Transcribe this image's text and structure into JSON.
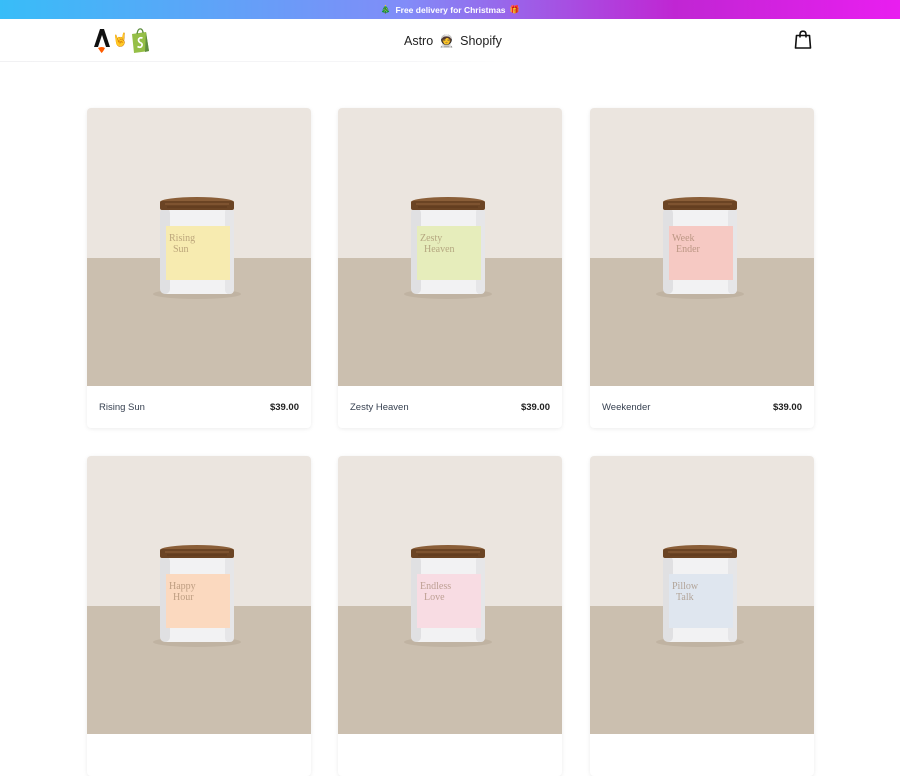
{
  "promo": {
    "text": "Free delivery for Christmas",
    "left_icon": "christmas-tree-icon",
    "right_icon": "gift-icon"
  },
  "header": {
    "brand_left": "Astro",
    "brand_icon": "astronaut-icon",
    "brand_right": "Shopify",
    "logo_icons": [
      "astro-logo-icon",
      "rock-hand-icon",
      "shopify-bag-icon"
    ],
    "cart_icon": "shopping-bag-icon"
  },
  "products": [
    {
      "name": "Rising Sun",
      "price": "$39.00",
      "label_color": "#f7ebb0",
      "label_text_1": "Rising",
      "label_text_2": "Sun"
    },
    {
      "name": "Zesty Heaven",
      "price": "$39.00",
      "label_color": "#e6edbb",
      "label_text_1": "Zesty",
      "label_text_2": "Heaven"
    },
    {
      "name": "Weekender",
      "price": "$39.00",
      "label_color": "#f6c9c3",
      "label_text_1": "Week",
      "label_text_2": "Ender"
    },
    {
      "name": "",
      "price": "",
      "label_color": "#fbd9bf",
      "label_text_1": "Happy",
      "label_text_2": "Hour"
    },
    {
      "name": "",
      "price": "",
      "label_color": "#f8dce3",
      "label_text_1": "Endless",
      "label_text_2": "Love"
    },
    {
      "name": "",
      "price": "",
      "label_color": "#dfe6ef",
      "label_text_1": "Pillow",
      "label_text_2": "Talk"
    }
  ],
  "colors": {
    "promo_gradient_start": "#38bdf8",
    "promo_gradient_end": "#e91ef0",
    "wall": "#ebe5df",
    "table": "#cbbfaf"
  }
}
